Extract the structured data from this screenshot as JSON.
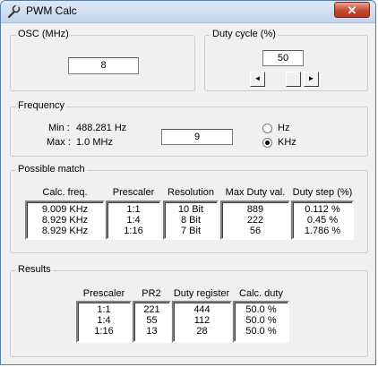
{
  "window": {
    "title": "PWM Calc",
    "close_glyph": "✕"
  },
  "osc": {
    "label": "OSC (MHz)",
    "value": "8"
  },
  "duty": {
    "label": "Duty cycle (%)",
    "value": "50",
    "slider_left": "◄",
    "slider_right": "►"
  },
  "frequency": {
    "label": "Frequency",
    "min_label": "Min :",
    "min_value": "488.281 Hz",
    "max_label": "Max :",
    "max_value": "1.0 MHz",
    "input_value": "9",
    "unit_options": [
      "Hz",
      "KHz"
    ],
    "selected_unit": "KHz"
  },
  "possible_match": {
    "label": "Possible match",
    "columns": [
      {
        "header": "Calc. freq.",
        "values": [
          "9.009 KHz",
          "8.929 KHz",
          "8.929 KHz"
        ]
      },
      {
        "header": "Prescaler",
        "values": [
          "1:1",
          "1:4",
          "1:16"
        ]
      },
      {
        "header": "Resolution",
        "values": [
          "10 Bit",
          "8 Bit",
          "7 Bit"
        ]
      },
      {
        "header": "Max Duty val.",
        "values": [
          "889",
          "222",
          "56"
        ]
      },
      {
        "header": "Duty step (%)",
        "values": [
          "0.112 %",
          "0.45 %",
          "1.786 %"
        ]
      }
    ]
  },
  "results": {
    "label": "Results",
    "columns": [
      {
        "header": "Prescaler",
        "values": [
          "1:1",
          "1:4",
          "1:16"
        ]
      },
      {
        "header": "PR2",
        "values": [
          "221",
          "55",
          "13"
        ]
      },
      {
        "header": "Duty register",
        "values": [
          "444",
          "112",
          "28"
        ]
      },
      {
        "header": "Calc. duty",
        "values": [
          "50.0 %",
          "50.0 %",
          "50.0 %"
        ]
      }
    ]
  }
}
